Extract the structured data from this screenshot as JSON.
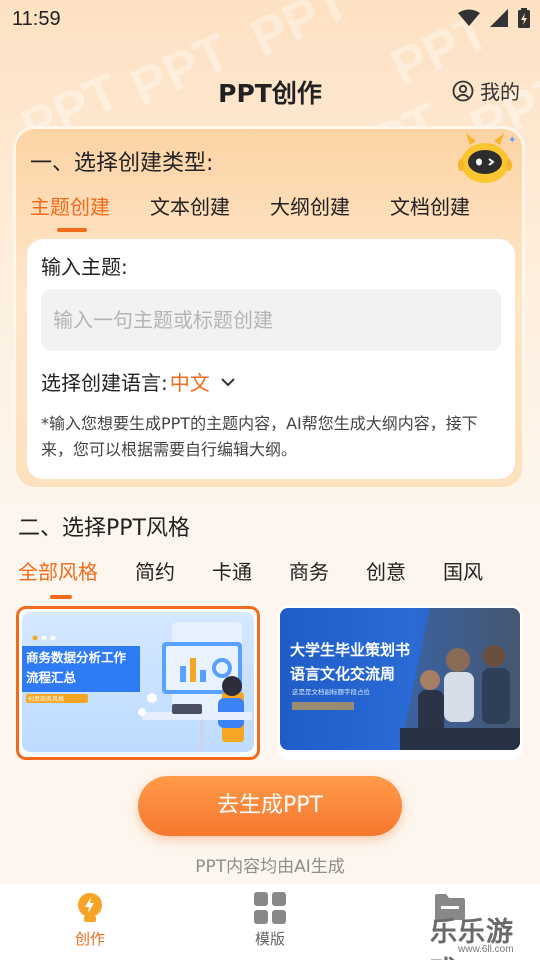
{
  "status_bar": {
    "time": "11:59"
  },
  "header": {
    "title": "PPT创作",
    "me_label": "我的"
  },
  "watermark": {
    "text": "PPT"
  },
  "step1": {
    "title": "一、选择创建类型:",
    "tabs": [
      {
        "label": "主题创建",
        "active": true
      },
      {
        "label": "文本创建",
        "active": false
      },
      {
        "label": "大纲创建",
        "active": false
      },
      {
        "label": "文档创建",
        "active": false
      }
    ],
    "input_label": "输入主题:",
    "input_placeholder": "输入一句主题或标题创建",
    "input_value": "",
    "language_label": "选择创建语言:",
    "language_value": "中文",
    "hint": "*输入您想要生成PPT的主题内容，AI帮您生成大纲内容，接下来，您可以根据需要自行编辑大纲。"
  },
  "step2": {
    "title": "二、选择PPT风格",
    "tabs": [
      {
        "label": "全部风格",
        "active": true
      },
      {
        "label": "简约",
        "active": false
      },
      {
        "label": "卡通",
        "active": false
      },
      {
        "label": "商务",
        "active": false
      },
      {
        "label": "创意",
        "active": false
      },
      {
        "label": "国风",
        "active": false
      }
    ],
    "templates": [
      {
        "title_line1": "商务数据分析工作",
        "title_line2": "流程汇总",
        "badge_text": "创意商务风格",
        "selected": true
      },
      {
        "title_line1": "大学生毕业策划书",
        "title_line2": "语言文化交流周",
        "subtitle": "这是是文档副标题字段占位",
        "selected": false
      }
    ]
  },
  "generate_button": {
    "label": "去生成PPT"
  },
  "ai_note": "PPT内容均由AI生成",
  "bottom_nav": [
    {
      "label": "创作",
      "icon": "lightning-bulb-icon",
      "active": true
    },
    {
      "label": "模版",
      "icon": "grid-icon",
      "active": false
    },
    {
      "label": "",
      "icon": "folder-icon",
      "active": false
    }
  ],
  "site_watermark": {
    "text": "乐乐游戏",
    "url": "www.6ll.com"
  },
  "colors": {
    "accent": "#f26a1b",
    "button": "#f6782d",
    "background": "#fde8cf"
  }
}
